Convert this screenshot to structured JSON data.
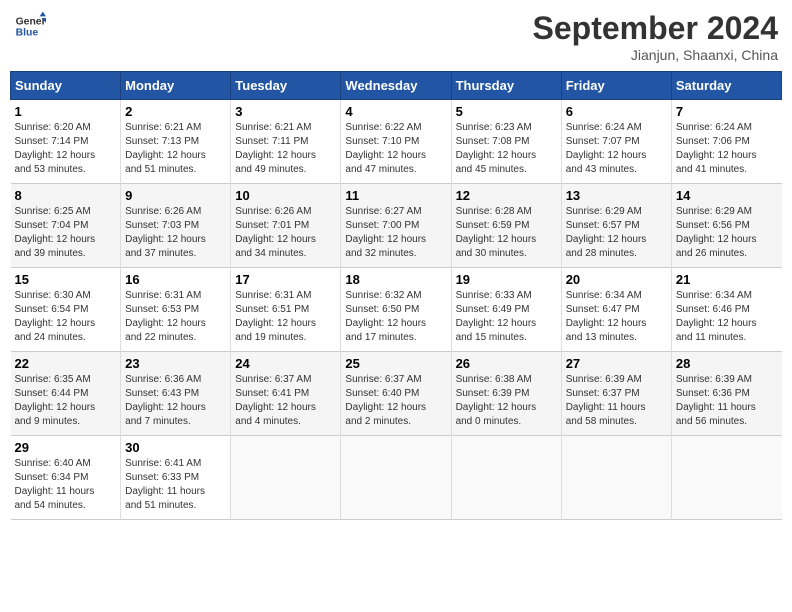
{
  "header": {
    "logo_line1": "General",
    "logo_line2": "Blue",
    "month": "September 2024",
    "location": "Jianjun, Shaanxi, China"
  },
  "days_of_week": [
    "Sunday",
    "Monday",
    "Tuesday",
    "Wednesday",
    "Thursday",
    "Friday",
    "Saturday"
  ],
  "weeks": [
    [
      {
        "day": "1",
        "detail": "Sunrise: 6:20 AM\nSunset: 7:14 PM\nDaylight: 12 hours\nand 53 minutes."
      },
      {
        "day": "2",
        "detail": "Sunrise: 6:21 AM\nSunset: 7:13 PM\nDaylight: 12 hours\nand 51 minutes."
      },
      {
        "day": "3",
        "detail": "Sunrise: 6:21 AM\nSunset: 7:11 PM\nDaylight: 12 hours\nand 49 minutes."
      },
      {
        "day": "4",
        "detail": "Sunrise: 6:22 AM\nSunset: 7:10 PM\nDaylight: 12 hours\nand 47 minutes."
      },
      {
        "day": "5",
        "detail": "Sunrise: 6:23 AM\nSunset: 7:08 PM\nDaylight: 12 hours\nand 45 minutes."
      },
      {
        "day": "6",
        "detail": "Sunrise: 6:24 AM\nSunset: 7:07 PM\nDaylight: 12 hours\nand 43 minutes."
      },
      {
        "day": "7",
        "detail": "Sunrise: 6:24 AM\nSunset: 7:06 PM\nDaylight: 12 hours\nand 41 minutes."
      }
    ],
    [
      {
        "day": "8",
        "detail": "Sunrise: 6:25 AM\nSunset: 7:04 PM\nDaylight: 12 hours\nand 39 minutes."
      },
      {
        "day": "9",
        "detail": "Sunrise: 6:26 AM\nSunset: 7:03 PM\nDaylight: 12 hours\nand 37 minutes."
      },
      {
        "day": "10",
        "detail": "Sunrise: 6:26 AM\nSunset: 7:01 PM\nDaylight: 12 hours\nand 34 minutes."
      },
      {
        "day": "11",
        "detail": "Sunrise: 6:27 AM\nSunset: 7:00 PM\nDaylight: 12 hours\nand 32 minutes."
      },
      {
        "day": "12",
        "detail": "Sunrise: 6:28 AM\nSunset: 6:59 PM\nDaylight: 12 hours\nand 30 minutes."
      },
      {
        "day": "13",
        "detail": "Sunrise: 6:29 AM\nSunset: 6:57 PM\nDaylight: 12 hours\nand 28 minutes."
      },
      {
        "day": "14",
        "detail": "Sunrise: 6:29 AM\nSunset: 6:56 PM\nDaylight: 12 hours\nand 26 minutes."
      }
    ],
    [
      {
        "day": "15",
        "detail": "Sunrise: 6:30 AM\nSunset: 6:54 PM\nDaylight: 12 hours\nand 24 minutes."
      },
      {
        "day": "16",
        "detail": "Sunrise: 6:31 AM\nSunset: 6:53 PM\nDaylight: 12 hours\nand 22 minutes."
      },
      {
        "day": "17",
        "detail": "Sunrise: 6:31 AM\nSunset: 6:51 PM\nDaylight: 12 hours\nand 19 minutes."
      },
      {
        "day": "18",
        "detail": "Sunrise: 6:32 AM\nSunset: 6:50 PM\nDaylight: 12 hours\nand 17 minutes."
      },
      {
        "day": "19",
        "detail": "Sunrise: 6:33 AM\nSunset: 6:49 PM\nDaylight: 12 hours\nand 15 minutes."
      },
      {
        "day": "20",
        "detail": "Sunrise: 6:34 AM\nSunset: 6:47 PM\nDaylight: 12 hours\nand 13 minutes."
      },
      {
        "day": "21",
        "detail": "Sunrise: 6:34 AM\nSunset: 6:46 PM\nDaylight: 12 hours\nand 11 minutes."
      }
    ],
    [
      {
        "day": "22",
        "detail": "Sunrise: 6:35 AM\nSunset: 6:44 PM\nDaylight: 12 hours\nand 9 minutes."
      },
      {
        "day": "23",
        "detail": "Sunrise: 6:36 AM\nSunset: 6:43 PM\nDaylight: 12 hours\nand 7 minutes."
      },
      {
        "day": "24",
        "detail": "Sunrise: 6:37 AM\nSunset: 6:41 PM\nDaylight: 12 hours\nand 4 minutes."
      },
      {
        "day": "25",
        "detail": "Sunrise: 6:37 AM\nSunset: 6:40 PM\nDaylight: 12 hours\nand 2 minutes."
      },
      {
        "day": "26",
        "detail": "Sunrise: 6:38 AM\nSunset: 6:39 PM\nDaylight: 12 hours\nand 0 minutes."
      },
      {
        "day": "27",
        "detail": "Sunrise: 6:39 AM\nSunset: 6:37 PM\nDaylight: 11 hours\nand 58 minutes."
      },
      {
        "day": "28",
        "detail": "Sunrise: 6:39 AM\nSunset: 6:36 PM\nDaylight: 11 hours\nand 56 minutes."
      }
    ],
    [
      {
        "day": "29",
        "detail": "Sunrise: 6:40 AM\nSunset: 6:34 PM\nDaylight: 11 hours\nand 54 minutes."
      },
      {
        "day": "30",
        "detail": "Sunrise: 6:41 AM\nSunset: 6:33 PM\nDaylight: 11 hours\nand 51 minutes."
      },
      {
        "day": "",
        "detail": ""
      },
      {
        "day": "",
        "detail": ""
      },
      {
        "day": "",
        "detail": ""
      },
      {
        "day": "",
        "detail": ""
      },
      {
        "day": "",
        "detail": ""
      }
    ]
  ]
}
